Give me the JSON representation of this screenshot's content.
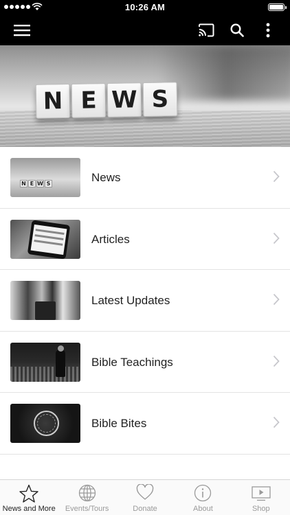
{
  "status_bar": {
    "time": "10:26 AM"
  },
  "hero": {
    "tiles": [
      "N",
      "E",
      "W",
      "S"
    ]
  },
  "list": {
    "items": [
      {
        "label": "News",
        "thumb_text": [
          "N",
          "E",
          "W",
          "S"
        ]
      },
      {
        "label": "Articles"
      },
      {
        "label": "Latest Updates"
      },
      {
        "label": "Bible Teachings"
      },
      {
        "label": "Bible Bites"
      }
    ]
  },
  "tabbar": {
    "tabs": [
      {
        "label": "News and More",
        "icon": "star-icon",
        "active": true
      },
      {
        "label": "Events/Tours",
        "icon": "globe-icon",
        "active": false
      },
      {
        "label": "Donate",
        "icon": "heart-icon",
        "active": false
      },
      {
        "label": "About",
        "icon": "info-icon",
        "active": false
      },
      {
        "label": "Shop",
        "icon": "play-screen-icon",
        "active": false
      }
    ]
  },
  "colors": {
    "bar": "#000000",
    "tab_active": "#222222",
    "tab_inactive": "#9a9a9a",
    "chevron": "#c7c7cc"
  }
}
